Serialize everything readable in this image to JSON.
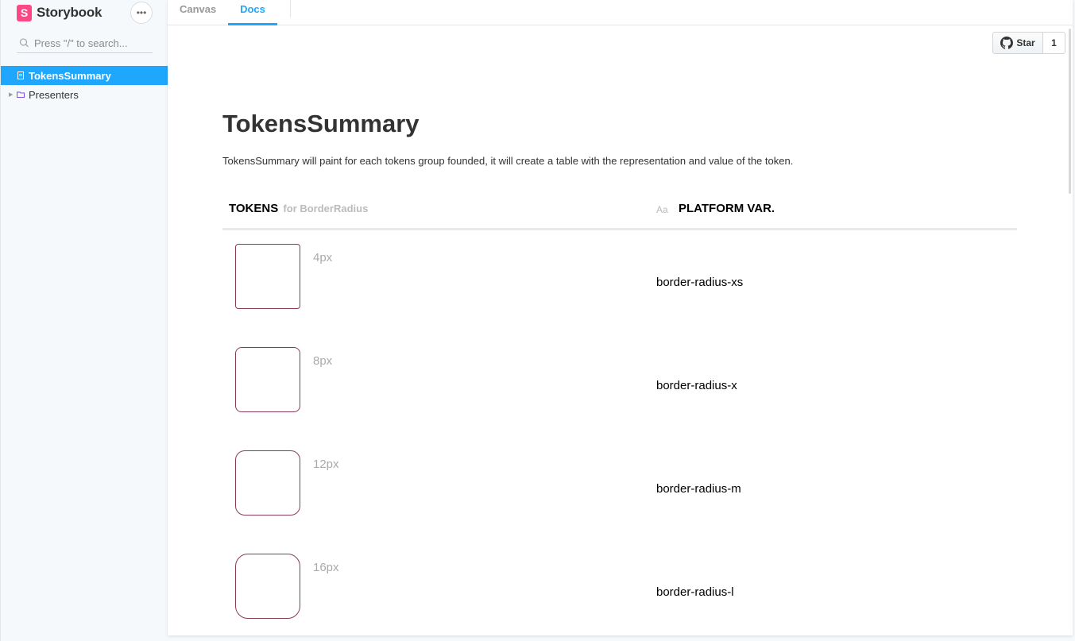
{
  "app": {
    "brand": "Storybook",
    "brand_mark": "S",
    "menu_dots": "•••",
    "search_placeholder": "Press \"/\" to search..."
  },
  "sidebar": {
    "items": [
      {
        "label": "TokensSummary",
        "icon": "document-icon",
        "active": true
      },
      {
        "label": "Presenters",
        "icon": "folder-icon",
        "active": false,
        "caret": "▶"
      }
    ]
  },
  "tabs": {
    "canvas": "Canvas",
    "docs": "Docs"
  },
  "github": {
    "star_label": "Star",
    "star_count": "1"
  },
  "doc": {
    "title": "TokensSummary",
    "description": "TokensSummary will paint for each tokens group founded, it will create a table with the representation and value of the token."
  },
  "table": {
    "header_tokens": "TOKENS",
    "header_for": "for BorderRadius",
    "header_aa": "Aa",
    "header_platform": "PLATFORM VAR.",
    "rows": [
      {
        "value": "4px",
        "var": "border-radius-xs",
        "radius": 4
      },
      {
        "value": "8px",
        "var": "border-radius-x",
        "radius": 8
      },
      {
        "value": "12px",
        "var": "border-radius-m",
        "radius": 12
      },
      {
        "value": "16px",
        "var": "border-radius-l",
        "radius": 16
      }
    ]
  },
  "colors": {
    "accent": "#1ea7fd",
    "brand": "#ff4785",
    "swatch_border": "#8b3a55"
  }
}
